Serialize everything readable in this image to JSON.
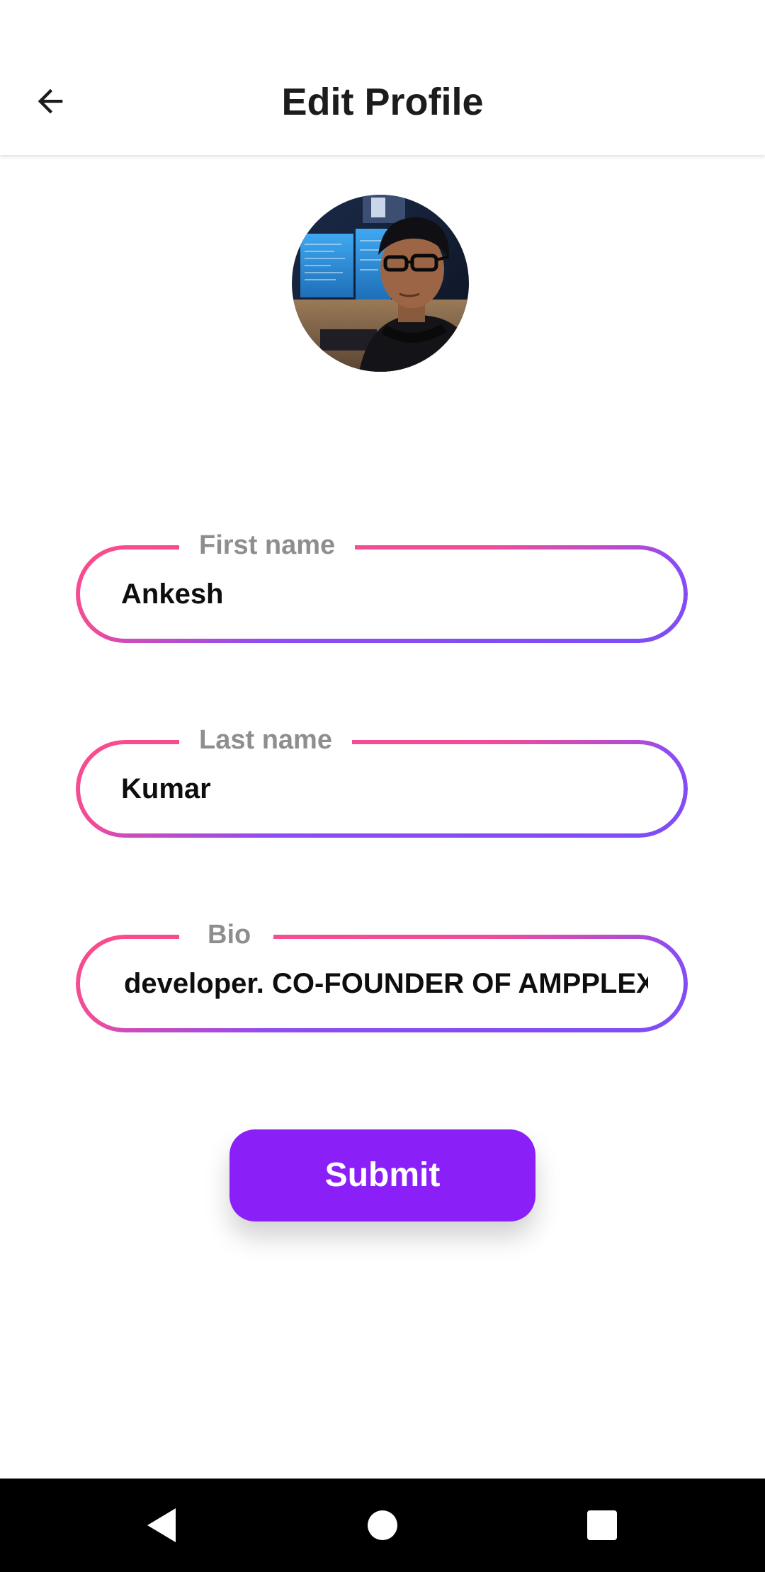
{
  "app_bar": {
    "title": "Edit Profile",
    "back_icon": "arrow-back-icon"
  },
  "profile": {
    "avatar_icon": "profile-photo"
  },
  "form": {
    "first_name": {
      "label": "First name",
      "value": "Ankesh"
    },
    "last_name": {
      "label": "Last name",
      "value": "Kumar"
    },
    "bio": {
      "label": "Bio",
      "value": "developer. CO-FOUNDER OF AMPPLEX"
    },
    "submit_label": "Submit"
  },
  "nav": {
    "back_icon": "nav-back-icon",
    "home_icon": "nav-home-icon",
    "recents_icon": "nav-recents-icon"
  },
  "colors": {
    "accent": "#8a1ff7",
    "gradient_pink": "#fb4b8a",
    "gradient_purple": "#7c4df7",
    "label_gray": "#8e8e8e"
  }
}
